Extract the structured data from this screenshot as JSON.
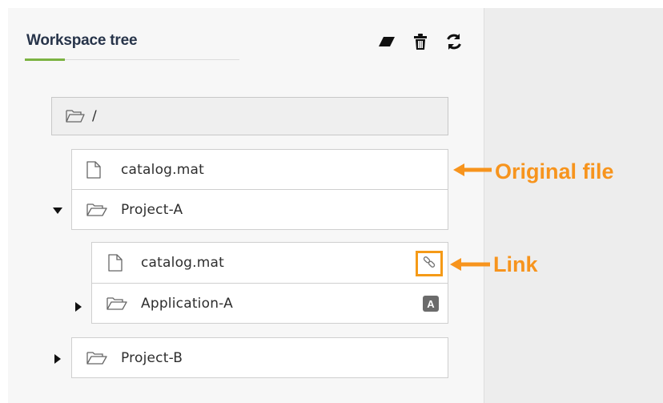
{
  "panel": {
    "title": "Workspace tree",
    "toolbar": [
      {
        "icon": "eraser-icon"
      },
      {
        "icon": "trash-icon"
      },
      {
        "icon": "refresh-icon"
      }
    ]
  },
  "tree": {
    "root": {
      "label": "/",
      "icon": "folder-open-icon"
    },
    "items": [
      {
        "label": "catalog.mat",
        "icon": "file-icon"
      },
      {
        "label": "Project-A",
        "icon": "folder-open-icon",
        "expanded": true
      },
      {
        "label": "catalog.mat",
        "icon": "file-icon",
        "badge_icon": "link-icon"
      },
      {
        "label": "Application-A",
        "icon": "folder-open-icon",
        "expanded": false,
        "badge": "A"
      },
      {
        "label": "Project-B",
        "icon": "folder-open-icon",
        "expanded": false
      }
    ]
  },
  "annotations": {
    "original": "Original file",
    "link": "Link"
  },
  "colors": {
    "accent": "#7cb342",
    "annotation": "#f7941d",
    "title": "#27344a"
  }
}
